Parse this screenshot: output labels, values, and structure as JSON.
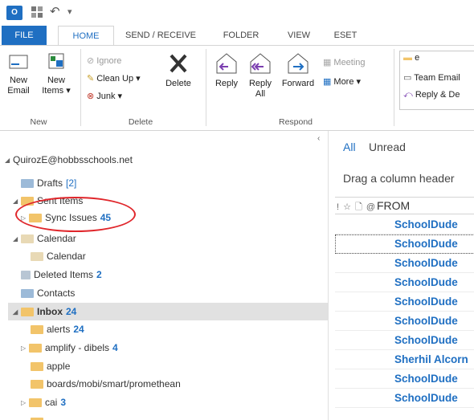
{
  "app": {
    "logo_text": "O"
  },
  "tabs": [
    {
      "label": "FILE"
    },
    {
      "label": "HOME"
    },
    {
      "label": "SEND / RECEIVE"
    },
    {
      "label": "FOLDER"
    },
    {
      "label": "VIEW"
    },
    {
      "label": "ESET"
    }
  ],
  "ribbon": {
    "new": {
      "new_email_1": "New",
      "new_email_2": "Email",
      "new_items_1": "New",
      "new_items_2": "Items ▾",
      "group": "New"
    },
    "delete": {
      "ignore": "Ignore",
      "clean_up": "Clean Up ▾",
      "junk": "Junk ▾",
      "delete": "Delete",
      "group": "Delete"
    },
    "respond": {
      "reply": "Reply",
      "reply_all_1": "Reply",
      "reply_all_2": "All",
      "forward": "Forward",
      "meeting": "Meeting",
      "more": "More ▾",
      "group": "Respond"
    },
    "quick_steps": {
      "item1": "e",
      "item2": "Team Email",
      "item3": "Reply & De"
    }
  },
  "folders": {
    "account": "QuirozE@hobbsschools.net",
    "drafts": {
      "name": "Drafts",
      "count": "[2]"
    },
    "sent": {
      "name": "Sent Items"
    },
    "sync": {
      "name": "Sync Issues",
      "count": "45"
    },
    "calendar_group": {
      "name": "Calendar"
    },
    "calendar": {
      "name": "Calendar"
    },
    "deleted": {
      "name": "Deleted Items",
      "count": "2"
    },
    "contacts": {
      "name": "Contacts"
    },
    "inbox": {
      "name": "Inbox",
      "count": "24"
    },
    "alerts": {
      "name": "alerts",
      "count": "24"
    },
    "amplify": {
      "name": "amplify - dibels",
      "count": "4"
    },
    "apple": {
      "name": "apple"
    },
    "boards": {
      "name": "boards/mobi/smart/promethean"
    },
    "cai": {
      "name": "cai",
      "count": "3"
    }
  },
  "message_list": {
    "filter_all": "All",
    "filter_unread": "Unread",
    "drag_hint": "Drag a column header",
    "col_icons": "! ☆ 🗋 @",
    "col_from": "FROM",
    "rows": [
      {
        "sender": "SchoolDude"
      },
      {
        "sender": "SchoolDude"
      },
      {
        "sender": "SchoolDude"
      },
      {
        "sender": "SchoolDude"
      },
      {
        "sender": "SchoolDude"
      },
      {
        "sender": "SchoolDude"
      },
      {
        "sender": "SchoolDude"
      },
      {
        "sender": "Sherhil Alcorn"
      },
      {
        "sender": "SchoolDude"
      },
      {
        "sender": "SchoolDude"
      }
    ]
  },
  "colors": {
    "accent": "#1f6fc2",
    "annotation": "#e0262b",
    "folder": "#f2c46a"
  }
}
